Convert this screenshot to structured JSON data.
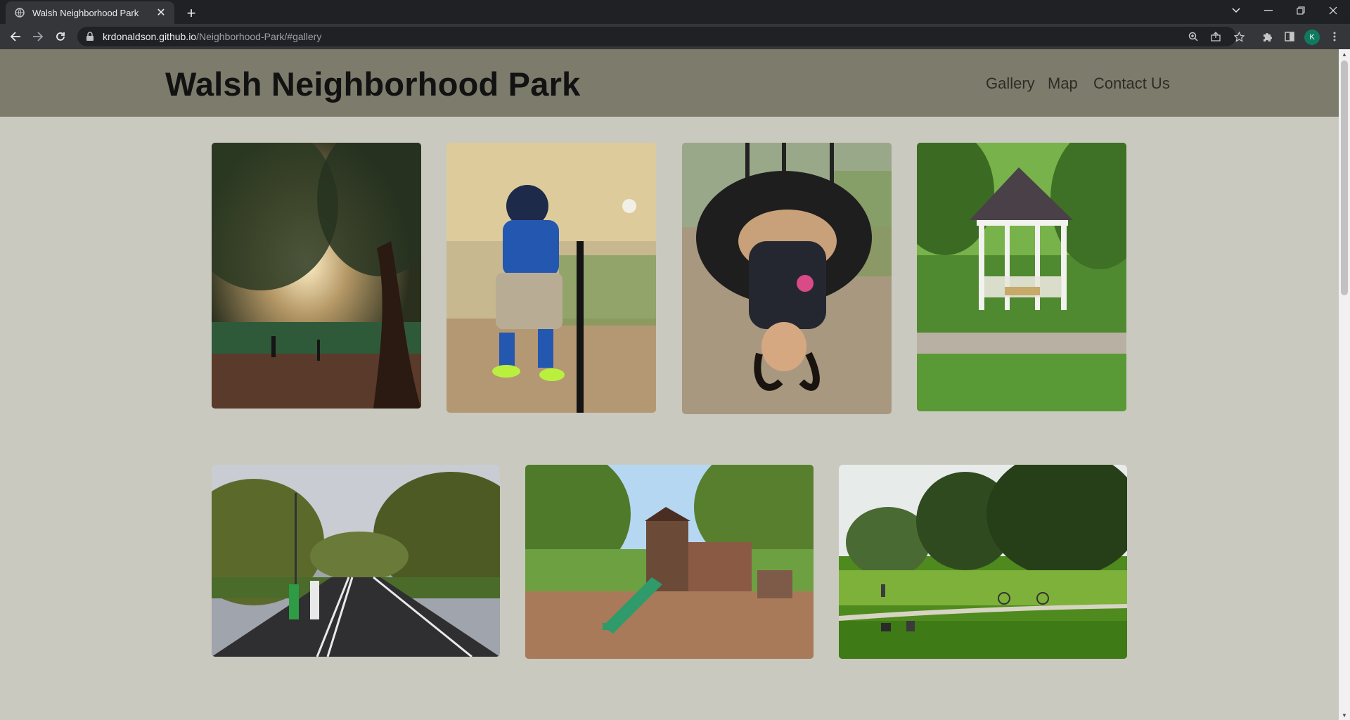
{
  "browser": {
    "tab_title": "Walsh Neighborhood Park",
    "tab_close": "✕",
    "new_tab": "+",
    "url_host": "krdonaldson.github.io",
    "url_path": "/Neighborhood-Park/#gallery",
    "profile_initial": "K",
    "icons": [
      "back-icon",
      "forward-icon",
      "reload-icon",
      "lock-icon",
      "zoom-icon",
      "share-icon",
      "star-icon",
      "extensions-icon",
      "side-panel-icon",
      "menu-icon"
    ]
  },
  "site": {
    "title": "Walsh Neighborhood Park",
    "nav": [
      "Gallery",
      "Map",
      "Contact Us"
    ],
    "colors": {
      "header": "#7d7c6c",
      "background": "#cac9bf",
      "title": "#121212"
    }
  },
  "gallery": {
    "photos": [
      "park-trees-sunset-dog-walkers",
      "child-tee-ball-batting",
      "girl-on-tire-swing",
      "white-gazebo-garden",
      "runners-on-park-road",
      "playground-with-slide",
      "park-meadow-cyclists"
    ]
  }
}
